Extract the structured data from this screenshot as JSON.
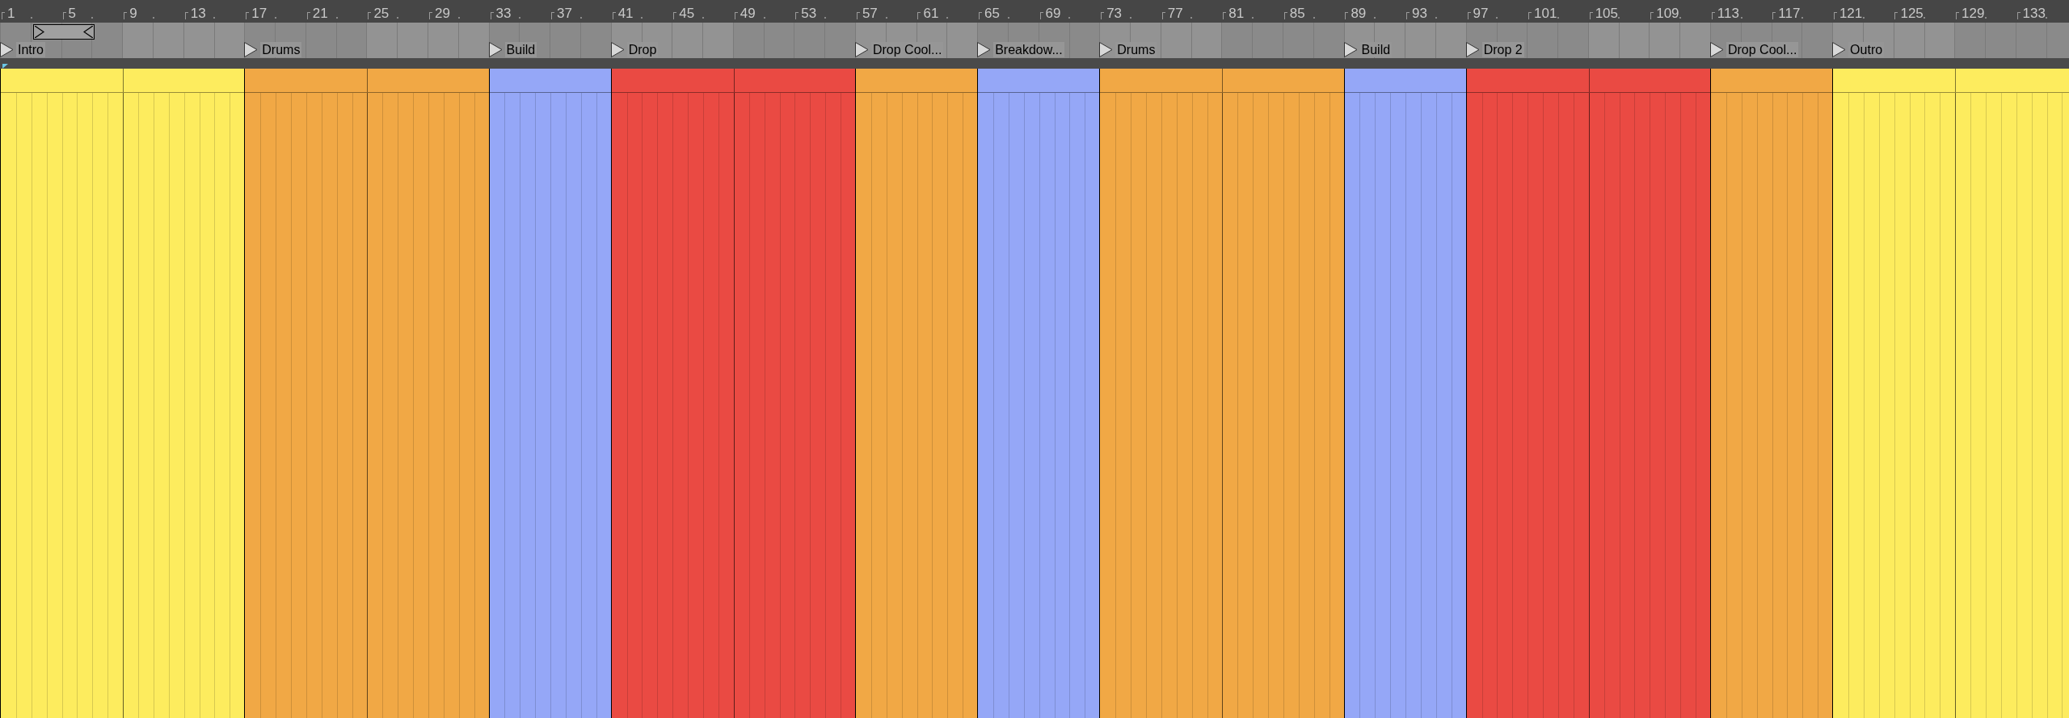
{
  "ruler": {
    "numbers": [
      "1",
      "5",
      "9",
      "13",
      "17",
      "21",
      "25",
      "29",
      "33",
      "37",
      "41",
      "45",
      "49",
      "53",
      "57",
      "61",
      "65",
      "69",
      "73",
      "77",
      "81",
      "85",
      "89",
      "93",
      "97",
      "101",
      "105",
      "109",
      "113",
      "117",
      "121",
      "125",
      "129",
      "133"
    ]
  },
  "sections": [
    {
      "label": "Intro",
      "kind": "long",
      "color": "#fdec5e"
    },
    {
      "label": "Drums",
      "kind": "long",
      "color": "#f1a845"
    },
    {
      "label": "Build",
      "kind": "short",
      "color": "#95a7f7"
    },
    {
      "label": "Drop",
      "kind": "long",
      "color": "#ea4a43"
    },
    {
      "label": "Drop Cool...",
      "kind": "short",
      "color": "#f1a845"
    },
    {
      "label": "Breakdow...",
      "kind": "short",
      "color": "#95a7f7"
    },
    {
      "label": "Drums",
      "kind": "long",
      "color": "#f1a845"
    },
    {
      "label": "Build",
      "kind": "short",
      "color": "#95a7f7"
    },
    {
      "label": "Drop 2",
      "kind": "long",
      "color": "#ea4a43"
    },
    {
      "label": "Drop Cool...",
      "kind": "short",
      "color": "#f1a845"
    },
    {
      "label": "Outro",
      "kind": "long",
      "color": "#fdec5e"
    }
  ]
}
